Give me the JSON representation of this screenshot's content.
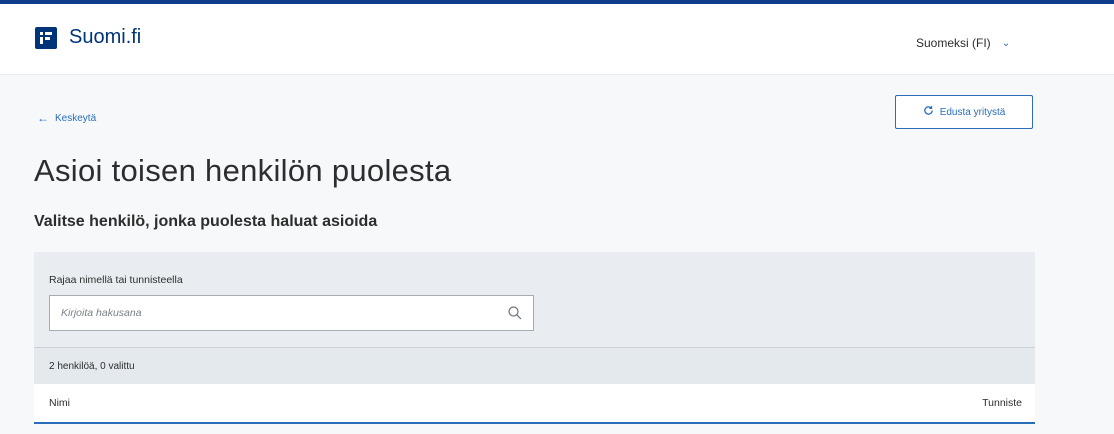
{
  "header": {
    "logo_text": "Suomi.fi",
    "language": "Suomeksi (FI)",
    "language_chevron": "chevron-down-icon"
  },
  "nav": {
    "back_label": "Keskeytä",
    "represent_company_label": "Edusta yritystä"
  },
  "main": {
    "title": "Asioi toisen henkilön puolesta",
    "subtitle": "Valitse henkilö, jonka puolesta haluat asioida"
  },
  "filter": {
    "label": "Rajaa nimellä tai tunnisteella",
    "placeholder": "Kirjoita hakusana",
    "value": ""
  },
  "results": {
    "count_text": "2 henkilöä, 0 valittu"
  },
  "table": {
    "columns": [
      "Nimi",
      "Tunniste"
    ]
  },
  "colors": {
    "brand": "#003479",
    "accent": "#2a6ebb",
    "panel": "#e9edf1"
  }
}
